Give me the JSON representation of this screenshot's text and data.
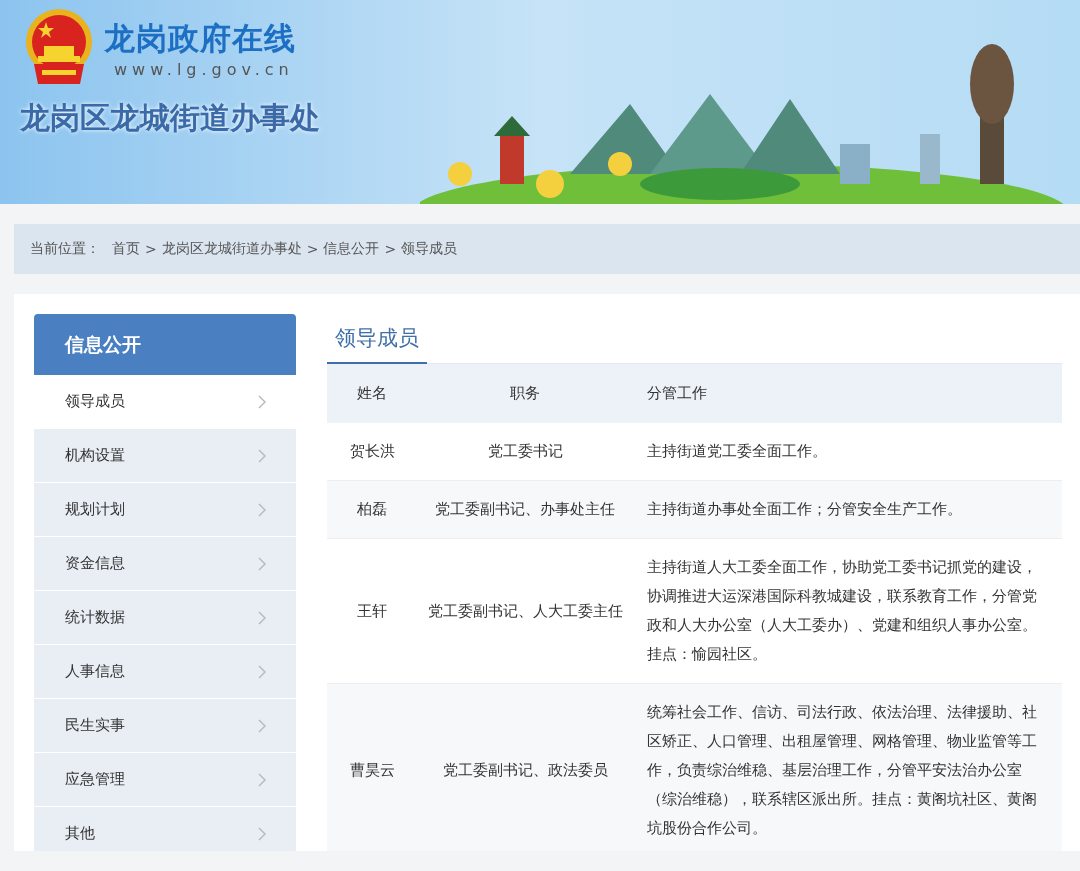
{
  "header": {
    "site_name": "龙岗政府在线",
    "site_url": "www.lg.gov.cn",
    "office_name": "龙岗区龙城街道办事处"
  },
  "breadcrumb": {
    "label": "当前位置：",
    "separator": ">",
    "items": [
      "首页",
      "龙岗区龙城街道办事处",
      "信息公开",
      "领导成员"
    ]
  },
  "sidebar": {
    "title": "信息公开",
    "items": [
      {
        "label": "领导成员",
        "selected": true
      },
      {
        "label": "机构设置",
        "selected": false
      },
      {
        "label": "规划计划",
        "selected": false
      },
      {
        "label": "资金信息",
        "selected": false
      },
      {
        "label": "统计数据",
        "selected": false
      },
      {
        "label": "人事信息",
        "selected": false
      },
      {
        "label": "民生实事",
        "selected": false
      },
      {
        "label": "应急管理",
        "selected": false
      },
      {
        "label": "其他",
        "selected": false
      }
    ]
  },
  "content": {
    "title": "领导成员",
    "table": {
      "columns": [
        "姓名",
        "职务",
        "分管工作"
      ],
      "rows": [
        [
          "贺长洪",
          "党工委书记",
          "主持街道党工委全面工作。"
        ],
        [
          "柏磊",
          "党工委副书记、办事处主任",
          "主持街道办事处全面工作；分管安全生产工作。"
        ],
        [
          "王轩",
          "党工委副书记、人大工委主任",
          "主持街道人大工委全面工作，协助党工委书记抓党的建设，协调推进大运深港国际科教城建设，联系教育工作，分管党政和人大办公室（人大工委办）、党建和组织人事办公室。挂点：愉园社区。"
        ],
        [
          "曹昊云",
          "党工委副书记、政法委员",
          "统筹社会工作、信访、司法行政、依法治理、法律援助、社区矫正、人口管理、出租屋管理、网格管理、物业监管等工作，负责综治维稳、基层治理工作，分管平安法治办公室（综治维稳），联系辖区派出所。挂点：黄阁坑社区、黄阁坑股份合作公司。"
        ]
      ]
    }
  }
}
